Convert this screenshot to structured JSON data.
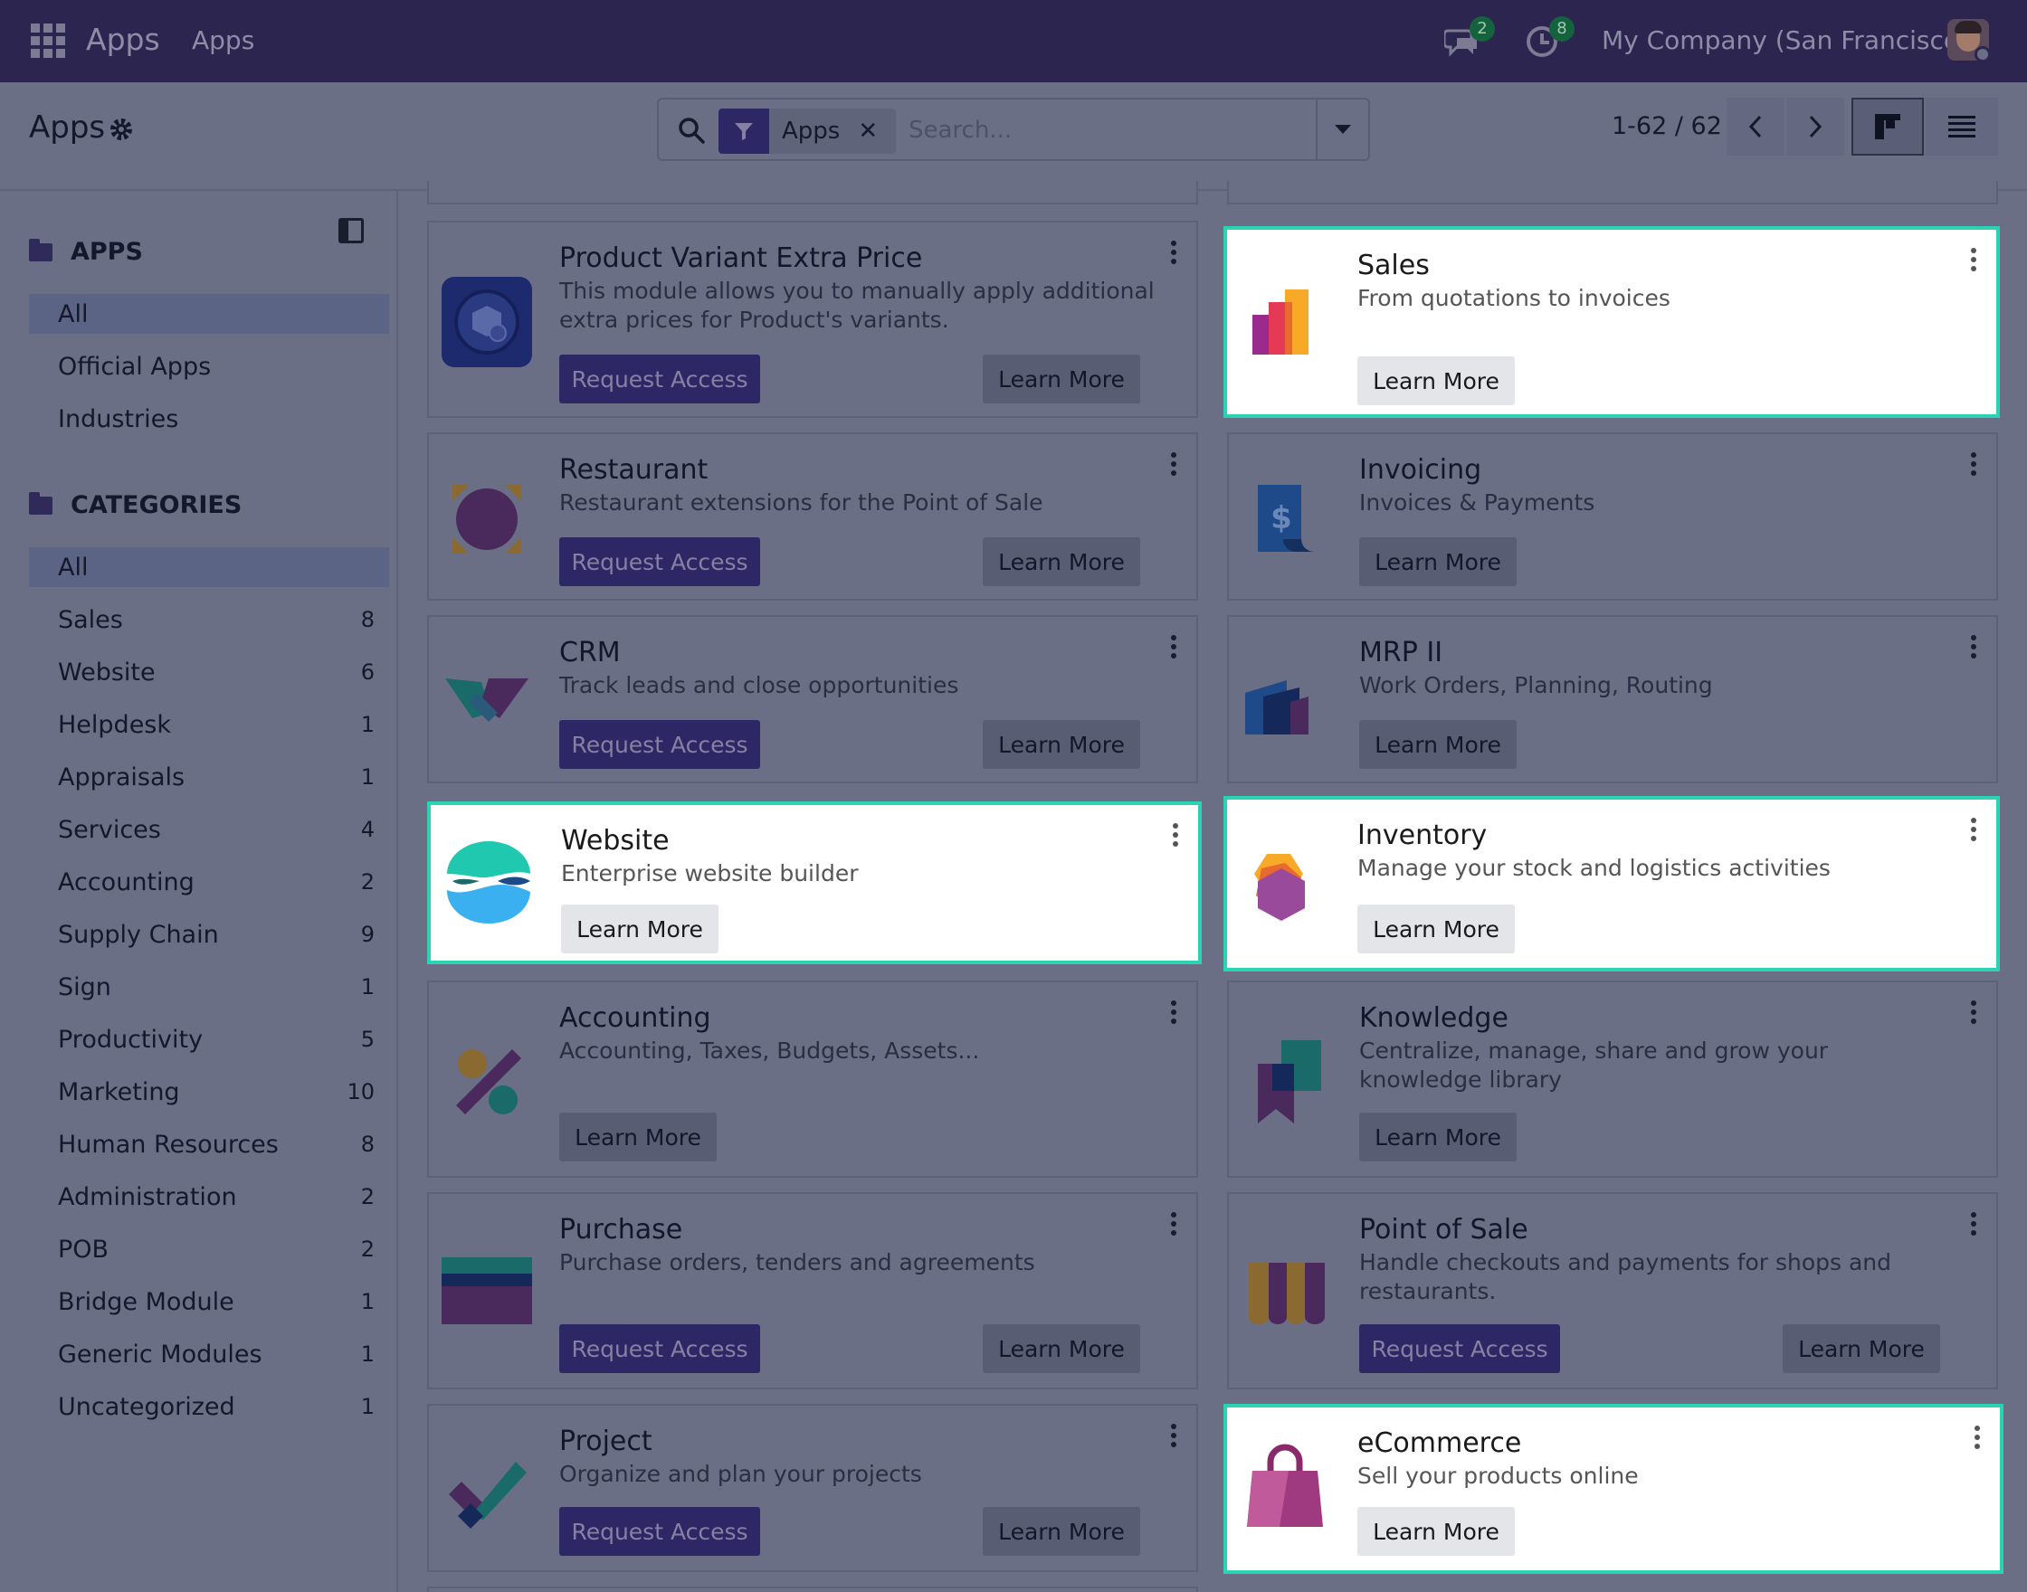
{
  "navbar": {
    "brand": "Apps",
    "menu_item": "Apps",
    "messages_count": "2",
    "activities_count": "8",
    "company": "My Company (San Francisco)"
  },
  "control": {
    "title": "Apps",
    "facet_label": "Apps",
    "search_placeholder": "Search...",
    "pager": "1-62 / 62"
  },
  "sidebar": {
    "apps_heading": "APPS",
    "apps_items": [
      "All",
      "Official Apps",
      "Industries"
    ],
    "categories_heading": "CATEGORIES",
    "categories": [
      {
        "label": "All",
        "count": ""
      },
      {
        "label": "Sales",
        "count": "8"
      },
      {
        "label": "Website",
        "count": "6"
      },
      {
        "label": "Helpdesk",
        "count": "1"
      },
      {
        "label": "Appraisals",
        "count": "1"
      },
      {
        "label": "Services",
        "count": "4"
      },
      {
        "label": "Accounting",
        "count": "2"
      },
      {
        "label": "Supply Chain",
        "count": "9"
      },
      {
        "label": "Sign",
        "count": "1"
      },
      {
        "label": "Productivity",
        "count": "5"
      },
      {
        "label": "Marketing",
        "count": "10"
      },
      {
        "label": "Human Resources",
        "count": "8"
      },
      {
        "label": "Administration",
        "count": "2"
      },
      {
        "label": "POB",
        "count": "2"
      },
      {
        "label": "Bridge Module",
        "count": "1"
      },
      {
        "label": "Generic Modules",
        "count": "1"
      },
      {
        "label": "Uncategorized",
        "count": "1"
      }
    ]
  },
  "buttons": {
    "request": "Request Access",
    "learn": "Learn More"
  },
  "cards": [
    {
      "title": "Product Variant Extra Price",
      "summary": "This module allows you to manually apply additional extra prices for Product's variants."
    },
    {
      "title": "Sales",
      "summary": "From quotations to invoices"
    },
    {
      "title": "Restaurant",
      "summary": "Restaurant extensions for the Point of Sale"
    },
    {
      "title": "Invoicing",
      "summary": "Invoices & Payments"
    },
    {
      "title": "CRM",
      "summary": "Track leads and close opportunities"
    },
    {
      "title": "MRP II",
      "summary": "Work Orders, Planning, Routing"
    },
    {
      "title": "Website",
      "summary": "Enterprise website builder"
    },
    {
      "title": "Inventory",
      "summary": "Manage your stock and logistics activities"
    },
    {
      "title": "Accounting",
      "summary": "Accounting, Taxes, Budgets, Assets..."
    },
    {
      "title": "Knowledge",
      "summary": "Centralize, manage, share and grow your knowledge library"
    },
    {
      "title": "Purchase",
      "summary": "Purchase orders, tenders and agreements"
    },
    {
      "title": "Point of Sale",
      "summary": "Handle checkouts and payments for shops and restaurants."
    },
    {
      "title": "Project",
      "summary": "Organize and plan your projects"
    },
    {
      "title": "eCommerce",
      "summary": "Sell your products online"
    }
  ],
  "colors": {
    "highlight_border": "#2ad3b4",
    "navbar": "#2c2550",
    "primary": "#2e2765"
  }
}
